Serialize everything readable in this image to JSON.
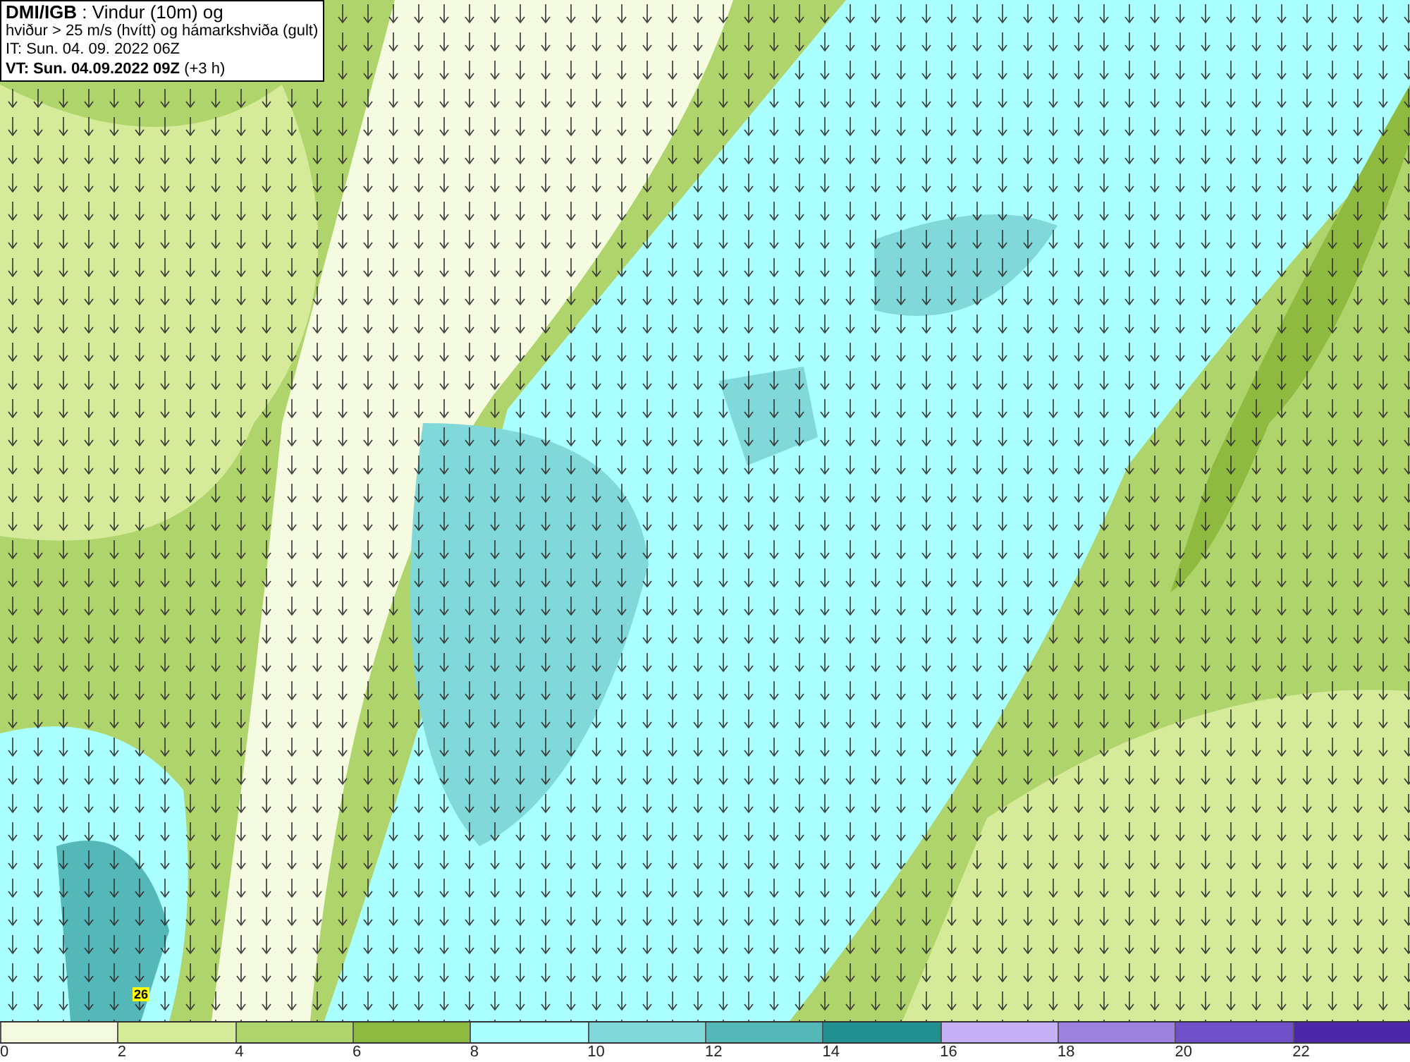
{
  "title_box": {
    "lines": [
      "**DMI/IGB** : Vindur (10m) og",
      "hviður > 25 m/s (hvítt) og hámarkshviða (gult)",
      "IT: Sun. 04. 09. 2022 06Z",
      "**VT: Sun. 04.09.2022 09Z** (+3 h)"
    ]
  },
  "max_gust_marker": {
    "text": "26"
  },
  "legend": [
    {
      "label": "0",
      "color": "#f5fbe0"
    },
    {
      "label": "2",
      "color": "#d5eb9a"
    },
    {
      "label": "4",
      "color": "#b0d46c"
    },
    {
      "label": "6",
      "color": "#8fba40"
    },
    {
      "label": "8",
      "color": "#aaffff"
    },
    {
      "label": "10",
      "color": "#80d8d8"
    },
    {
      "label": "12",
      "color": "#55b8b8"
    },
    {
      "label": "14",
      "color": "#209090"
    },
    {
      "label": "16",
      "color": "#c4b0f4"
    },
    {
      "label": "18",
      "color": "#9e82e0"
    },
    {
      "label": "20",
      "color": "#7050c8"
    },
    {
      "label": "22",
      "color": "#4a28a8"
    }
  ]
}
